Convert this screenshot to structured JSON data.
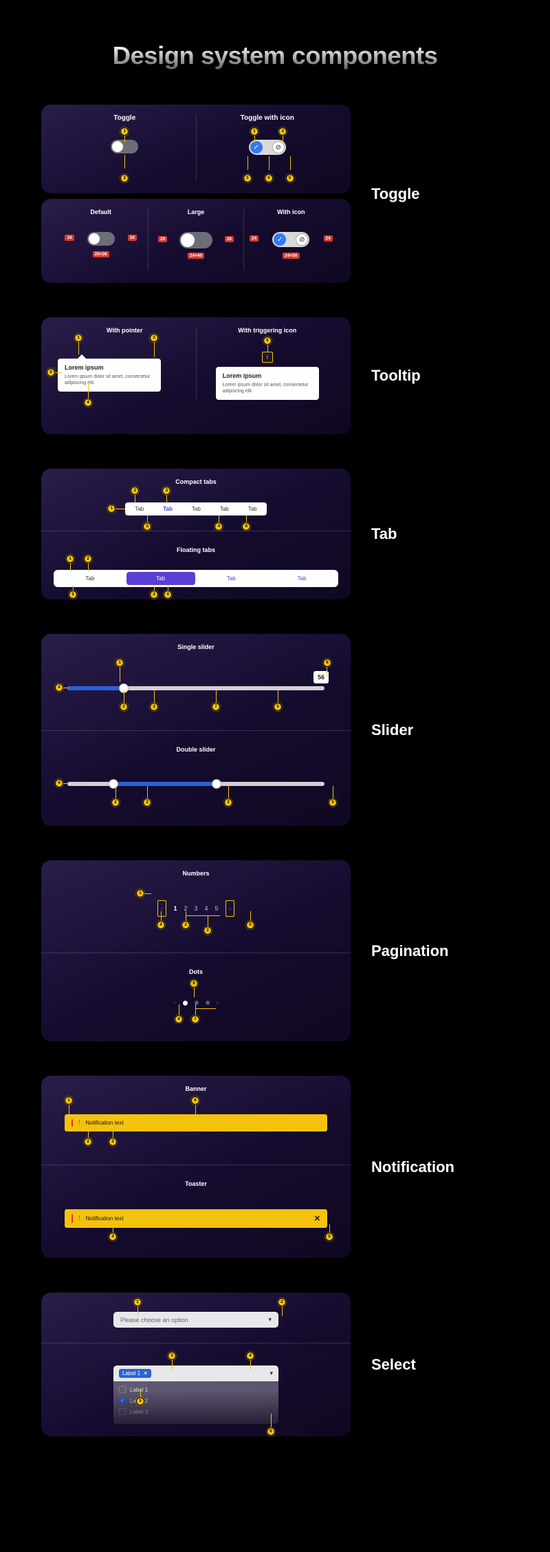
{
  "title": "Design system components",
  "sections": {
    "toggle": {
      "label": "Toggle",
      "row1": {
        "a": "Toggle",
        "b": "Toggle with icon"
      },
      "row2": {
        "a": "Default",
        "b": "Large",
        "c": "With icon"
      },
      "dims": {
        "d16": "16",
        "d20x36": "20×36",
        "d20": "20",
        "d24x40": "24×40",
        "d24": "24",
        "d24x56": "24×56"
      }
    },
    "tooltip": {
      "label": "Tooltip",
      "a": "With pointer",
      "b": "With triggering icon",
      "tt_title": "Lorem ipsum",
      "tt_body": "Lorem ipsum dolor sit amet, consectetur adipiscing elit.",
      "trigger_glyph": "i"
    },
    "tab": {
      "label": "Tab",
      "compact_label": "Compact tabs",
      "floating_label": "Floating tabs",
      "items": [
        "Tab",
        "Tab",
        "Tab",
        "Tab",
        "Tab"
      ],
      "float_items": [
        "Tab",
        "Tab",
        "Tab",
        "Tab"
      ]
    },
    "slider": {
      "label": "Slider",
      "single": "Single slider",
      "double": "Double slider",
      "value": "56"
    },
    "pagination": {
      "label": "Pagination",
      "numbers": "Numbers",
      "dots": "Dots",
      "pages": [
        "1",
        "2",
        "3",
        "4",
        "5"
      ]
    },
    "notification": {
      "label": "Notification",
      "banner": "Banner",
      "toaster": "Toaster",
      "text": "Notification text"
    },
    "select": {
      "label": "Select",
      "placeholder": "Please choose an option",
      "chip": "Label 1",
      "options": [
        "Label 1",
        "Label 2",
        "Label 3"
      ]
    }
  }
}
